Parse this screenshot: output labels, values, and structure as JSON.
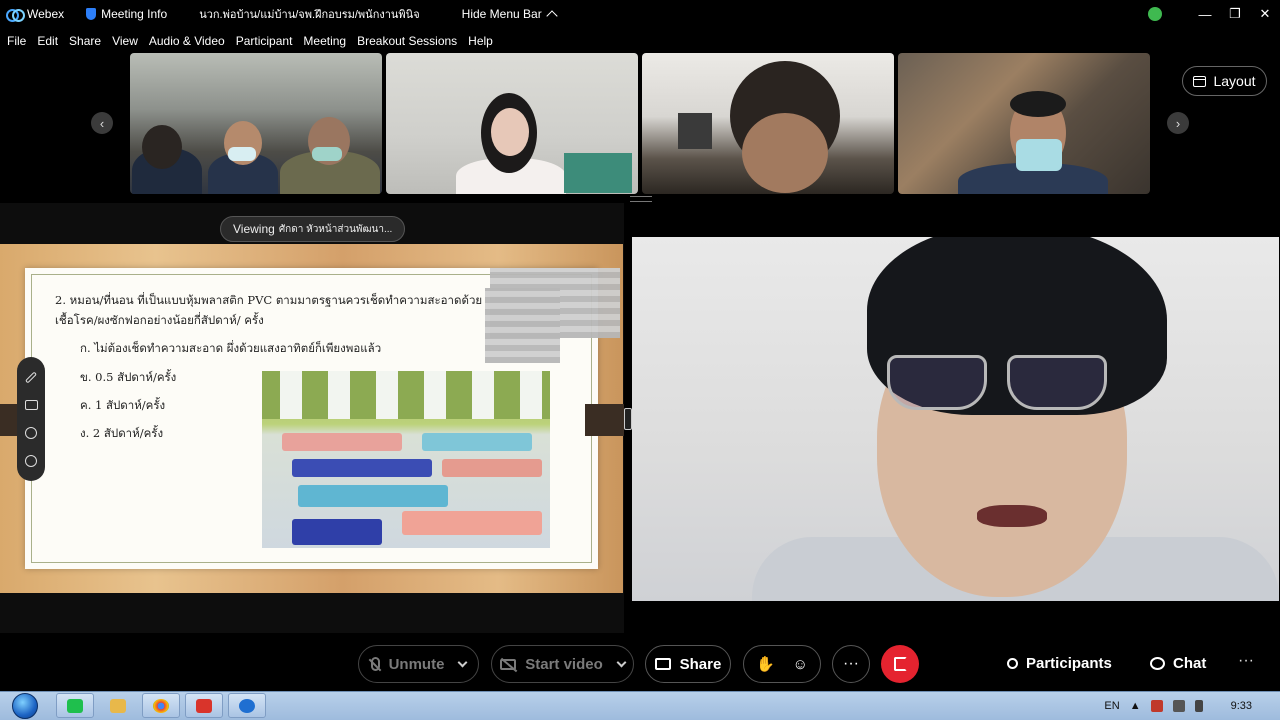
{
  "titlebar": {
    "app_name": "Webex",
    "meeting_info": "Meeting Info",
    "meeting_title": "นวก.พ่อบ้าน/แม่บ้าน/จพ.ฝึกอบรม/พนักงานพินิจ",
    "hide_menu_bar": "Hide Menu Bar"
  },
  "menu": {
    "items": [
      "File",
      "Edit",
      "Share",
      "View",
      "Audio & Video",
      "Participant",
      "Meeting",
      "Breakout Sessions",
      "Help"
    ]
  },
  "layout_button": "Layout",
  "viewing": {
    "prefix": "Viewing",
    "name": "ศักดา หัวหน้าส่วนพัฒนา..."
  },
  "slide": {
    "question_line1": "2. หมอน/ที่นอน ที่เป็นแบบหุ้มพลาสติก PVC ตามมาตรฐานควรเช็ดทำความสะอาดด้วย",
    "question_line2": "เชื้อโรค/ผงซักฟอกอย่างน้อยกี่สัปดาห์/ ครั้ง",
    "option_a": "ก. ไม่ต้องเช็ดทำความสะอาด ผึ่งด้วยแสงอาทิตย์ก็เพียงพอแล้ว",
    "option_b": "ข. 0.5 สัปดาห์/ครั้ง",
    "option_c": "ค. 1 สัปดาห์/ครั้ง",
    "option_d": "ง. 2 สัปดาห์/ครั้ง"
  },
  "controls": {
    "unmute": "Unmute",
    "start_video": "Start video",
    "share": "Share",
    "more": "···",
    "participants": "Participants",
    "chat": "Chat",
    "more_right": "···"
  },
  "taskbar": {
    "language": "EN",
    "clock": "9:33"
  },
  "colors": {
    "leave_red": "#e5232f",
    "background": "#000000",
    "taskbar": "#a9c4e4"
  }
}
